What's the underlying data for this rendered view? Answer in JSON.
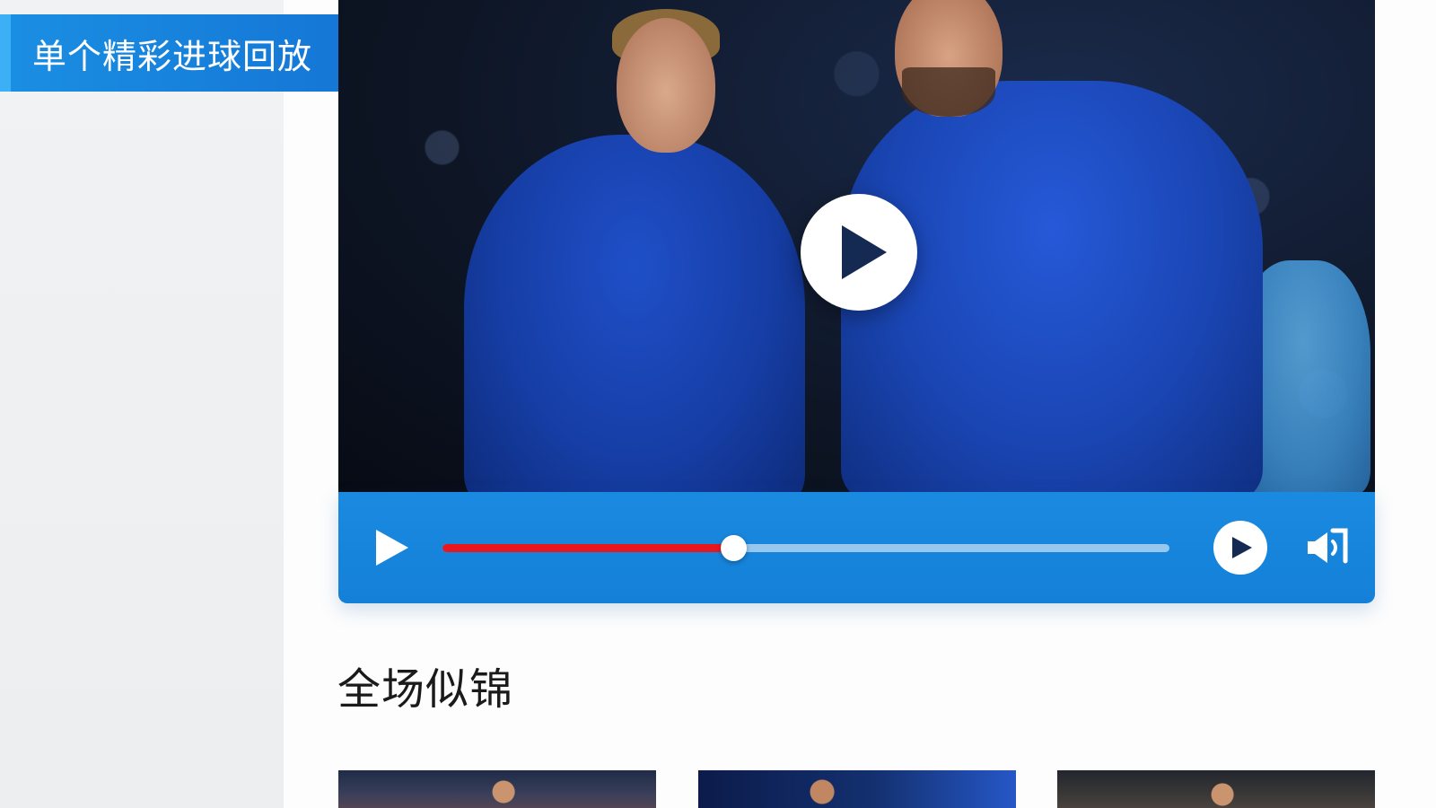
{
  "sidebar": {
    "active_item": {
      "label": "单个精彩进球回放",
      "icon": ""
    }
  },
  "video_player": {
    "progress": 0.4,
    "controls": {
      "play_icon": "play-icon",
      "center_play_icon": "play-circle-icon",
      "secondary_play_icon": "play-circle-icon",
      "volume_icon": "volume-icon"
    }
  },
  "main": {
    "section_title": "全场似锦"
  },
  "colors": {
    "accent": "#1a8ae0",
    "progress": "#e8171f",
    "active_sidebar": "#1577d6"
  }
}
